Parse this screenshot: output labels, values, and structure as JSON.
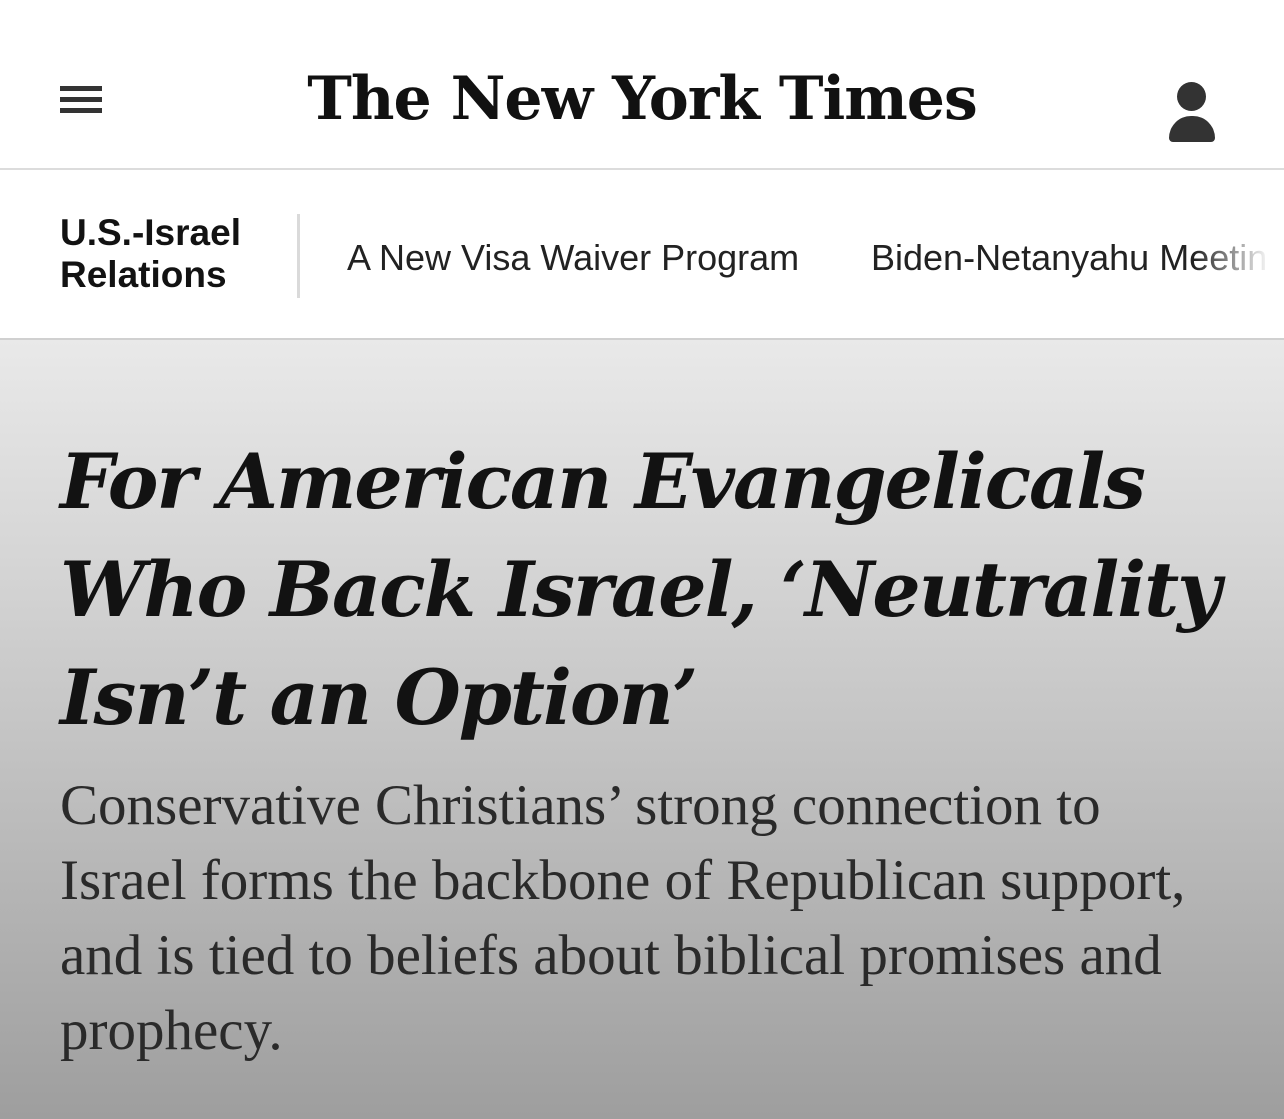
{
  "masthead": {
    "logo_text": "The New York Times",
    "menu_icon": "hamburger-menu-icon",
    "account_icon": "user-account-icon"
  },
  "section_nav": {
    "label": "U.S.-Israel Relations",
    "links": [
      {
        "label": "A New Visa Waiver Program"
      },
      {
        "label": "Biden-Netanyahu Meetin"
      }
    ]
  },
  "article": {
    "headline": "For American Evangelicals Who Back Israel, ‘Neutrality Isn’t an Option’",
    "summary": "Conservative Christians’ strong connection to Israel forms the backbone of Republican support, and is tied to beliefs about biblical promises and prophecy."
  },
  "colors": {
    "text": "#121212",
    "hero_gradient_top": "#e9e9e9",
    "hero_gradient_bottom": "#9e9e9e"
  }
}
